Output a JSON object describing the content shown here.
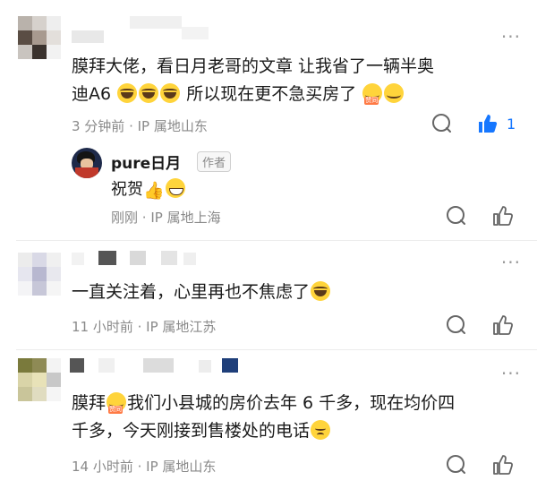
{
  "comments": [
    {
      "text_line1_a": "膜拜大佬，看日月老哥的文章 让我省了一辆半奥",
      "text_line2_a": "迪A6",
      "text_line2_b": "所以现在更不急买房了",
      "emoji_badge": "赞同",
      "time": "3 分钟前",
      "location": "· IP 属地山东",
      "like_count": "1",
      "reply": {
        "author": "pure日月",
        "author_badge": "作者",
        "text": "祝贺",
        "time": "刚刚",
        "location": "· IP 属地上海"
      }
    },
    {
      "text": "一直关注着，心里再也不焦虑了",
      "time": "11 小时前",
      "location": "· IP 属地江苏"
    },
    {
      "text_line1_a": "膜拜",
      "text_line1_b": "我们小县城的房价去年 6 千多，现在均价四",
      "text_line2": "千多，今天刚接到售楼处的电话",
      "emoji_badge": "赞同",
      "time": "14 小时前",
      "location": "· IP 属地山东"
    }
  ],
  "icons": {
    "more": "more-horizontal-icon",
    "comment": "comment-bubble-icon",
    "like": "thumbs-up-icon"
  },
  "colors": {
    "accent": "#1677ff",
    "meta": "#8a8a8a",
    "text": "#1a1a1a"
  }
}
